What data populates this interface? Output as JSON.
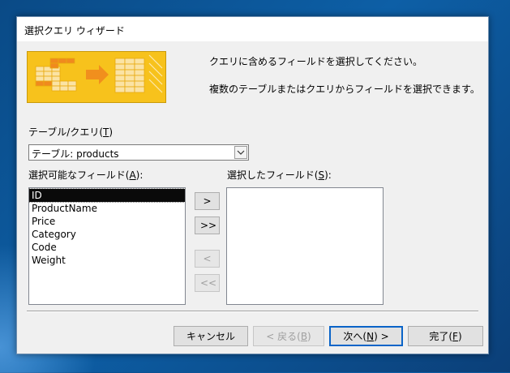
{
  "window": {
    "title": "選択クエリ ウィザード"
  },
  "intro": {
    "line1": "クエリに含めるフィールドを選択してください。",
    "line2": "複数のテーブルまたはクエリからフィールドを選択できます。"
  },
  "table_query": {
    "label": "テーブル/クエリ",
    "accel": "T",
    "selected_value": "テーブル: products"
  },
  "available_fields": {
    "label": "選択可能なフィールド",
    "accel": "A",
    "items": [
      "ID",
      "ProductName",
      "Price",
      "Category",
      "Code",
      "Weight"
    ],
    "selected_index": 0
  },
  "selected_fields": {
    "label": "選択したフィールド",
    "accel": "S",
    "items": []
  },
  "move_buttons": {
    "add_one": ">",
    "add_all": ">>",
    "remove_one": "<",
    "remove_all": "<<"
  },
  "footer": {
    "cancel": "キャンセル",
    "back_text": "< 戻る",
    "back_accel": "B",
    "next_text": "次へ",
    "next_accel": "N",
    "next_suffix": " >",
    "finish_text": "完了",
    "finish_accel": "F"
  }
}
